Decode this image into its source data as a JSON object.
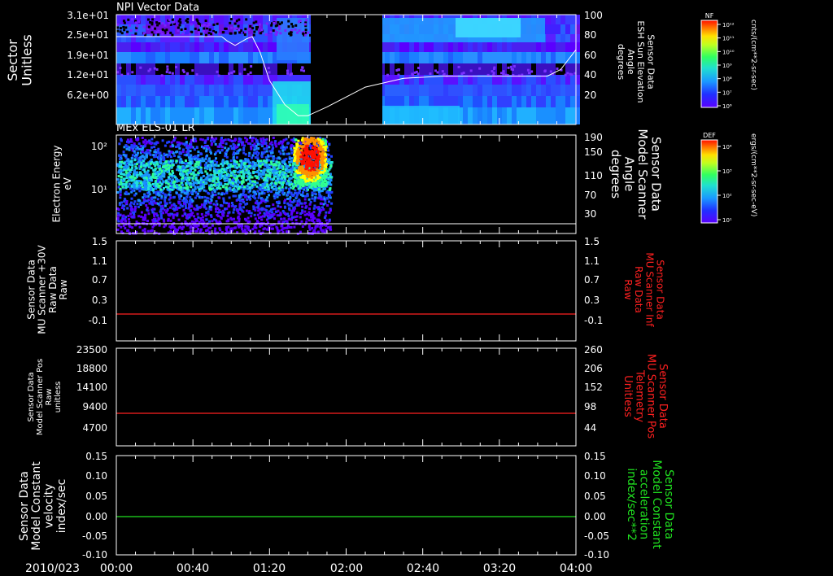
{
  "colors": {
    "background": "#000000",
    "axis": "#ffffff",
    "raw_trace": "#ff2020",
    "model_velocity_trace": "#20e020",
    "right_label_red": "#ff2020",
    "right_label_green": "#20e020",
    "spectrogram_palette": [
      "#5a00ff",
      "#2040ff",
      "#1a90ff",
      "#20e0e0",
      "#30ff90",
      "#a0ff30",
      "#ffff00",
      "#ff9000",
      "#ff1000"
    ]
  },
  "time_axis": {
    "date_label": "2010/023",
    "tick_labels": [
      "00:00",
      "00:40",
      "01:20",
      "02:00",
      "02:40",
      "03:20",
      "04:00"
    ],
    "range_minutes": [
      0,
      240
    ]
  },
  "chart_data": [
    {
      "id": "npi",
      "type": "heatmap",
      "title": "NPI Vector Data",
      "ylabel_left": "Sector\nUnitless",
      "ylabel_right": "Sensor Data\nESH Sun Elevation\nAngle\ndegrees",
      "left_ticks": [
        "3.1e+01",
        "2.5e+01",
        "1.9e+01",
        "1.2e+01",
        "6.2e+00"
      ],
      "right_ticks": [
        "100",
        "80",
        "60",
        "40",
        "20"
      ],
      "ylim_left": [
        0,
        31
      ],
      "ylim_right": [
        0,
        100
      ],
      "colorbar": {
        "label": "NF",
        "tick_labels": [
          "10¹²",
          "10¹¹",
          "10¹⁰",
          "10⁹",
          "10⁸",
          "10⁷",
          "10⁶"
        ],
        "units": "cnts/(cm**2-sr-sec)"
      },
      "data_gap_minutes": [
        77,
        106
      ],
      "overlay_line": {
        "name": "ESH Sun Elevation Angle",
        "x": [
          0,
          30,
          55,
          58,
          62,
          68,
          71,
          75,
          80,
          88,
          95,
          100,
          110,
          130,
          150,
          170,
          200,
          225,
          232,
          240
        ],
        "y": [
          80,
          80,
          80,
          76,
          72,
          78,
          80,
          66,
          40,
          18,
          8,
          8,
          16,
          34,
          42,
          44,
          44,
          44,
          50,
          68
        ]
      }
    },
    {
      "id": "els",
      "type": "heatmap",
      "title": "MEx ELS-01 LR",
      "ylabel_left": "Electron Energy\neV",
      "ylabel_right": "Sensor Data\nModel Scanner\nAngle\ndegrees",
      "left_ticks": [
        "10²",
        "10¹"
      ],
      "right_ticks": [
        "190",
        "150",
        "110",
        "70",
        "30"
      ],
      "ylim_right": [
        0,
        190
      ],
      "colorbar": {
        "label": "DEF",
        "tick_labels": [
          "10⁴",
          "10³",
          "10²",
          "10¹"
        ],
        "units": "ergs/(cm**2-sr-sec-eV)"
      },
      "data_end_minutes": 112,
      "overlay_line": {
        "name": "Model Scanner Angle",
        "x": [
          0,
          240
        ],
        "y": [
          5,
          5
        ]
      }
    },
    {
      "id": "mu_raw",
      "type": "line",
      "ylabel_left": "Sensor Data\nMU Scanner +30V\nRaw Data\nRaw",
      "ylabel_right": "Sensor Data\nMU Scanner Inf\nRaw Data\nRaw",
      "left_ticks": [
        "1.5",
        "1.1",
        "0.7",
        "0.3",
        "-0.1"
      ],
      "right_ticks": [
        "1.5",
        "1.1",
        "0.7",
        "0.3",
        "-0.1"
      ],
      "ylim": [
        -0.35,
        1.5
      ],
      "series": [
        {
          "x": [
            0,
            240
          ],
          "y": [
            0.0,
            0.0
          ]
        }
      ]
    },
    {
      "id": "mu_pos",
      "type": "line",
      "ylabel_left": "Sensor Data\nModel Scanner Pos\nRaw\nunitless",
      "ylabel_right": "Sensor Data\nMU Scanner Pos\nTelemetry\nUnitless",
      "left_ticks": [
        "23500",
        "18800",
        "14100",
        "9400",
        "4700"
      ],
      "right_ticks": [
        "260",
        "206",
        "152",
        "98",
        "44"
      ],
      "ylim_left": [
        0,
        23500
      ],
      "ylim_right": [
        0,
        260
      ],
      "series": [
        {
          "x": [
            0,
            240
          ],
          "y": [
            8200,
            8200
          ]
        }
      ]
    },
    {
      "id": "model_const",
      "type": "line",
      "ylabel_left": "Sensor Data\nModel Constant\nvelocity\nindex/sec",
      "ylabel_right": "Sensor Data\nModel Constant\nacceleration\nindex/sec**2",
      "left_ticks": [
        "0.15",
        "0.10",
        "0.05",
        "0.00",
        "-0.05",
        "-0.10"
      ],
      "right_ticks": [
        "0.15",
        "0.10",
        "0.05",
        "0.00",
        "-0.05",
        "-0.10"
      ],
      "ylim": [
        -0.1,
        0.15
      ],
      "series": [
        {
          "x": [
            0,
            240
          ],
          "y": [
            0.0,
            0.0
          ]
        }
      ]
    }
  ]
}
